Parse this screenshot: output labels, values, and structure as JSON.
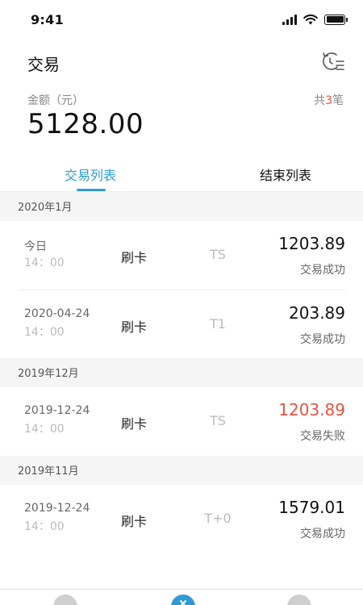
{
  "status_bar": {
    "time": "9:41"
  },
  "header": {
    "title": "交易"
  },
  "summary": {
    "amount_label": "金额（元）",
    "amount_value": "5128.00",
    "count_prefix": "共",
    "count_value": "3",
    "count_suffix": "笔"
  },
  "tabs": [
    {
      "label": "交易列表",
      "active": true
    },
    {
      "label": "结束列表",
      "active": false
    }
  ],
  "groups": [
    {
      "month": "2020年1月",
      "transactions": [
        {
          "date": "今日",
          "time": "14：00",
          "type": "刷卡",
          "channel": "TS",
          "amount": "1203.89",
          "status": "交易成功"
        },
        {
          "date": "2020-04-24",
          "time": "14：00",
          "type": "刷卡",
          "channel": "T1",
          "amount": "203.89",
          "status": "交易成功"
        }
      ]
    },
    {
      "month": "2019年12月",
      "transactions": [
        {
          "date": "2019-12-24",
          "time": "14：00",
          "type": "刷卡",
          "channel": "TS",
          "amount": "1203.89",
          "status": "交易失败"
        }
      ]
    },
    {
      "month": "2019年11月",
      "transactions": [
        {
          "date": "2019-12-24",
          "time": "14：00",
          "type": "刷卡",
          "channel": "T+0",
          "amount": "1579.01",
          "status": "交易成功"
        }
      ]
    }
  ],
  "colors": {
    "accent": "#2f9bd6",
    "failure": "#e8533f"
  }
}
